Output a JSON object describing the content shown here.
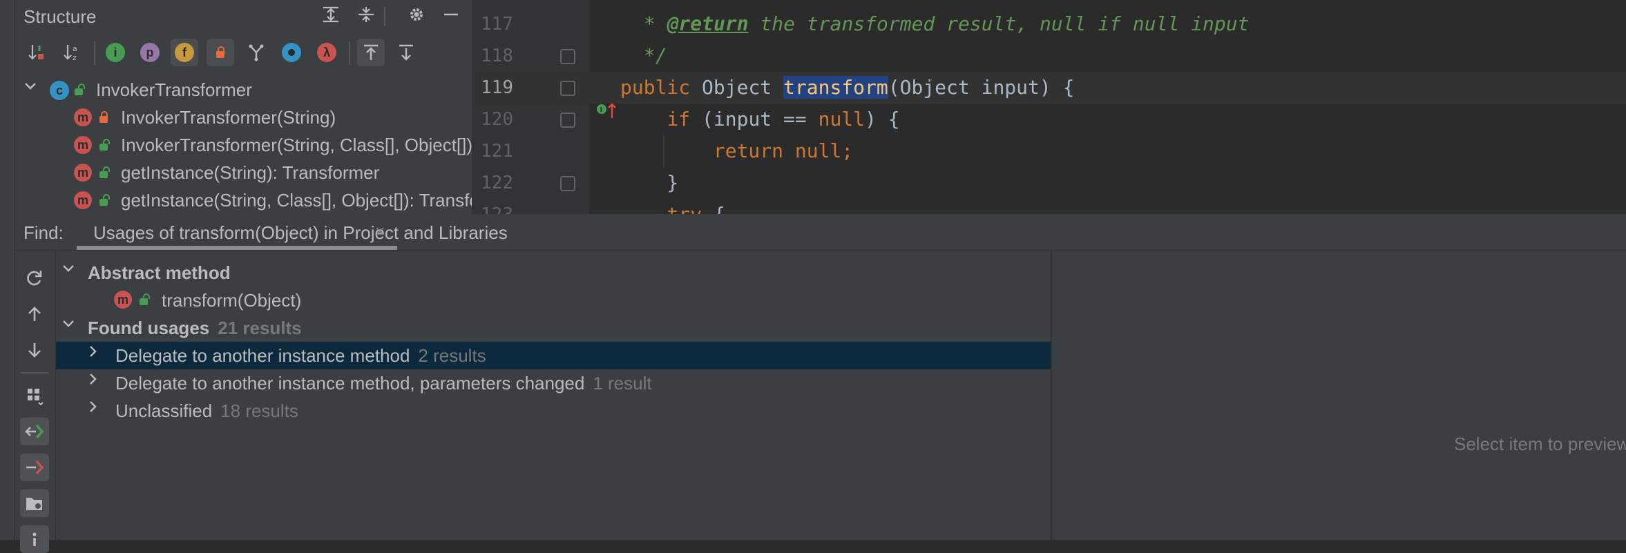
{
  "structure": {
    "title": "Structure",
    "header_icons": [
      "expand-all-icon",
      "collapse-all-icon",
      "gear-icon",
      "minimize-icon"
    ],
    "toolbar": [
      {
        "name": "sort-by-visibility-icon",
        "glyph": "↓⇣"
      },
      {
        "name": "sort-alphabetically-icon",
        "glyph": "↓a"
      },
      {
        "name": "show-inherited-icon",
        "glyph": "i",
        "color": "#499c54"
      },
      {
        "name": "show-properties-icon",
        "glyph": "p",
        "color": "#9876aa"
      },
      {
        "name": "show-fields-icon",
        "glyph": "f",
        "color": "#c59a3c"
      },
      {
        "name": "show-non-public-icon",
        "glyph": "🔒",
        "color": "#e46a3c"
      },
      {
        "name": "show-lambdas-icon",
        "glyph": "Y"
      },
      {
        "name": "show-anonymous-icon",
        "glyph": "●",
        "color": "#3592c4"
      },
      {
        "name": "show-lambda-icon",
        "glyph": "λ",
        "color": "#c75450"
      },
      {
        "name": "autoscroll-to-source-icon",
        "glyph": "⤒"
      },
      {
        "name": "autoscroll-from-source-icon",
        "glyph": "⤓"
      }
    ],
    "tree": [
      {
        "label": "InvokerTransformer",
        "kind": "class"
      },
      {
        "label": "InvokerTransformer(String)",
        "kind": "method",
        "access": "private"
      },
      {
        "label": "InvokerTransformer(String, Class[], Object[])",
        "kind": "method",
        "access": "public"
      },
      {
        "label": "getInstance(String): Transformer",
        "kind": "method",
        "access": "public"
      },
      {
        "label": "getInstance(String, Class[], Object[]): Transformer",
        "kind": "method",
        "access": "public"
      }
    ]
  },
  "editor": {
    "lines": [
      {
        "no": "117",
        "text": " * @return the transformed result, null if null input"
      },
      {
        "no": "118",
        "text": " */"
      },
      {
        "no": "119",
        "text": "public Object transform(Object input) {"
      },
      {
        "no": "120",
        "text": "    if (input == null) {"
      },
      {
        "no": "121",
        "text": "        return null;"
      },
      {
        "no": "122",
        "text": "    }"
      },
      {
        "no": "123",
        "text": "    try {"
      }
    ],
    "colors": {
      "keyword": "#cc7832",
      "doc": "#629755",
      "function": "#ffc66d",
      "selection": "#214283"
    }
  },
  "find": {
    "label": "Find:",
    "tab_title": "Usages of transform(Object) in Project and Libraries",
    "sidebar_icons": [
      "rerun-icon",
      "previous-occurrence-icon",
      "next-occurrence-icon",
      "group-by-icon",
      "navigate-to-source-icon",
      "exclude-icon",
      "open-in-folder-icon",
      "info-icon"
    ],
    "abstract_group": "Abstract method",
    "abstract_item": "transform(Object)",
    "found_label": "Found usages",
    "found_count": "21 results",
    "groups": [
      {
        "label": "Delegate to another instance method",
        "count": "2 results"
      },
      {
        "label": "Delegate to another instance method, parameters changed",
        "count": "1 result"
      },
      {
        "label": "Unclassified",
        "count": "18 results"
      }
    ],
    "preview_hint": "Select item to preview"
  }
}
